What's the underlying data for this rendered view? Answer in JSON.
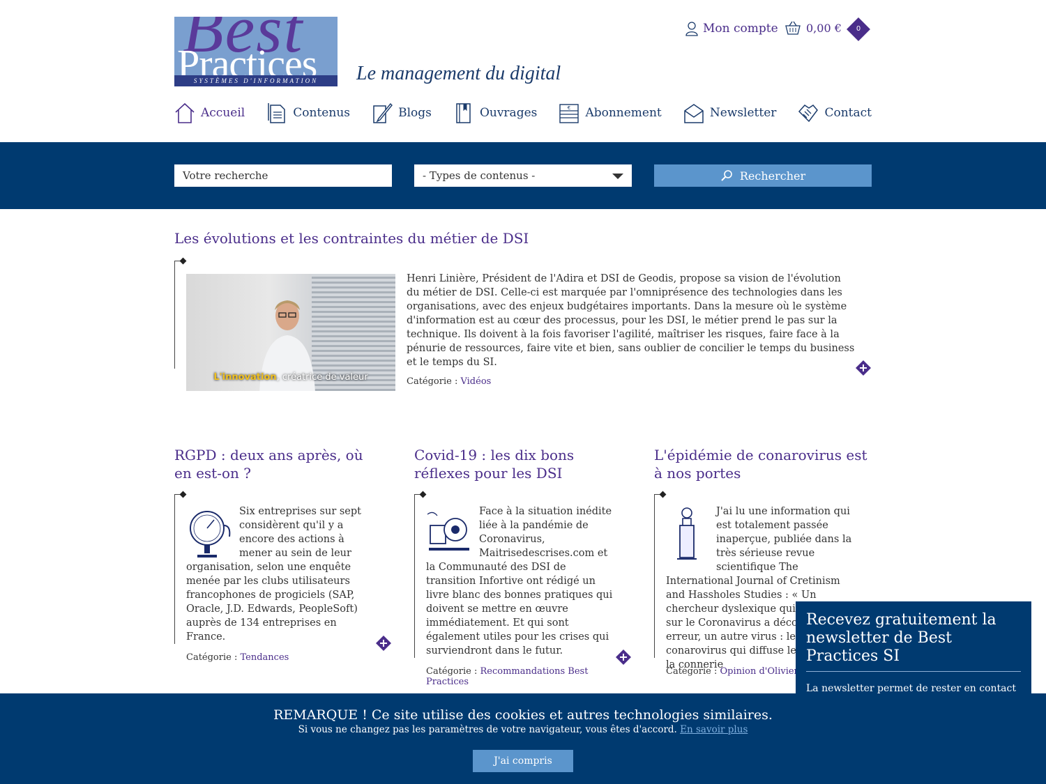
{
  "header": {
    "logo_big": "Best",
    "logo_mid": "Practices",
    "logo_bar": "SYSTÈMES D'INFORMATION",
    "tagline": "Le management du digital",
    "account_label": "Mon compte",
    "cart_total": "0,00 €",
    "cart_count": "0"
  },
  "nav": [
    {
      "label": "Accueil",
      "icon": "home-icon"
    },
    {
      "label": "Contenus",
      "icon": "document-icon"
    },
    {
      "label": "Blogs",
      "icon": "pen-icon"
    },
    {
      "label": "Ouvrages",
      "icon": "book-icon"
    },
    {
      "label": "Abonnement",
      "icon": "euro-stack-icon"
    },
    {
      "label": "Newsletter",
      "icon": "envelope-icon"
    },
    {
      "label": "Contact",
      "icon": "handshake-icon"
    }
  ],
  "search": {
    "placeholder": "Votre recherche",
    "type_select": "- Types de contenus -",
    "button": "Rechercher"
  },
  "featured": {
    "title": "Les évolutions et les contraintes du métier de DSI",
    "video_caption_highlight": "L'innovation",
    "video_caption_rest": ", créatrice de valeur",
    "text": "Henri Linière, Président de l'Adira et DSI de Geodis, propose sa vision de l'évolution du métier de DSI. Celle-ci est marquée par l'omniprésence des technologies dans les organisations, avec des enjeux budgétaires importants. Dans la mesure où le système d'information est au cœur des processus, pour les DSI, le métier prend le pas sur la technique. Ils doivent à la fois favoriser l'agilité, maîtriser les risques, faire face à la pénurie de ressources, faire vite et bien, sans oublier de concilier le temps du business et le temps du SI.",
    "category_label": "Catégorie :",
    "category": "Vidéos"
  },
  "articles": [
    {
      "title": "RGPD : deux ans après, où en est-on ?",
      "text": "Six entreprises sur sept considèrent qu'il y a encore des actions à mener au sein de leur organisation, selon une enquête menée par les clubs utilisateurs francophones de progiciels (SAP, Oracle, J.D. Edwards, PeopleSoft) auprès de 134 entreprises en France.",
      "category_label": "Catégorie :",
      "category": "Tendances"
    },
    {
      "title": "Covid-19 : les dix bons réflexes pour les DSI",
      "text": "Face à la situation inédite liée à la pandémie de Coronavirus, Maitrisedescrises.com et la Communauté des DSI de transition Infortive ont rédigé un livre blanc des bonnes pratiques qui doivent se mettre en œuvre immédiatement. Et qui sont également utiles pour les crises qui surviendront dans le futur.",
      "category_label": "Catégorie :",
      "category": "Recommandations Best Practices"
    },
    {
      "title": "L'épidémie de conarovirus est à nos portes",
      "text": "J'ai lu une information qui est totalement passée inaperçue, publiée dans la très sérieuse revue scientifique The International Journal of Cretinism and Hassholes Studies : « Un chercheur dyslexique qui travaillait sur le Coronavirus a découvert par erreur, un autre virus : le conarovirus qui diffuse les gènes de la connerie",
      "category_label": "Catégorie :",
      "category": "Opinion d'Olivier Soubié"
    }
  ],
  "newsletter_popup": {
    "title": "Recevez gratuitement la newsletter de Best Practices SI",
    "text": "La newsletter permet de rester en contact"
  },
  "cookie": {
    "title": "REMARQUE ! Ce site utilise des cookies et autres technologies similaires.",
    "text": "Si vous ne changez pas les paramètres de votre navigateur, vous êtes d'accord.",
    "link": "En savoir plus",
    "button": "J'ai compris"
  },
  "colors": {
    "brand_purple": "#4a2d8a",
    "navy": "#003a70",
    "button_blue": "#5b95cc"
  }
}
